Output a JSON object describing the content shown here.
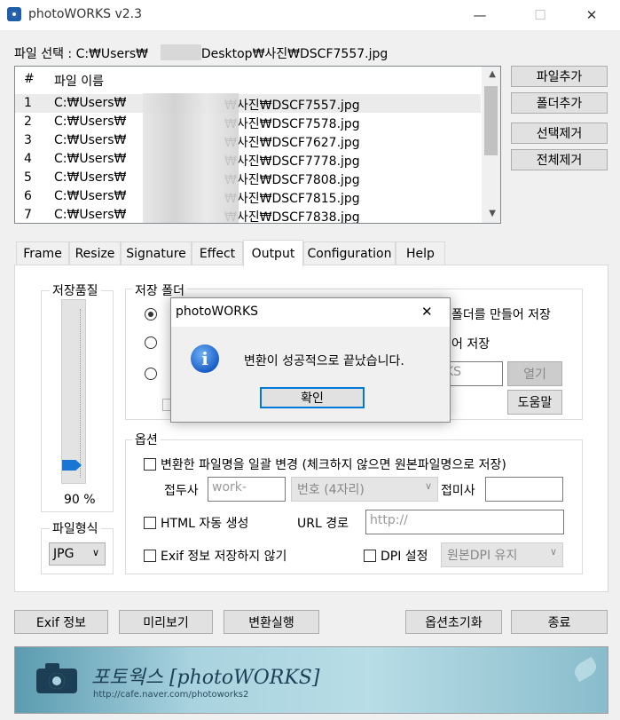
{
  "window": {
    "title": "photoWORKS v2.3",
    "minimize": "—",
    "maximize": "☐",
    "close": "✕"
  },
  "file_select": {
    "label": "파일 선택 : C:₩Users₩",
    "suffix": "₩Desktop₩사진₩DSCF7557.jpg"
  },
  "file_list": {
    "col_num": "#",
    "col_name": "파일 이름",
    "rows": [
      {
        "num": "1",
        "path": "C:₩Users₩",
        "file": "₩사진₩DSCF7557.jpg"
      },
      {
        "num": "2",
        "path": "C:₩Users₩",
        "file": "₩사진₩DSCF7578.jpg"
      },
      {
        "num": "3",
        "path": "C:₩Users₩",
        "file": "₩사진₩DSCF7627.jpg"
      },
      {
        "num": "4",
        "path": "C:₩Users₩",
        "file": "₩사진₩DSCF7778.jpg"
      },
      {
        "num": "5",
        "path": "C:₩Users₩",
        "file": "₩사진₩DSCF7808.jpg"
      },
      {
        "num": "6",
        "path": "C:₩Users₩",
        "file": "₩사진₩DSCF7815.jpg"
      },
      {
        "num": "7",
        "path": "C:₩Users₩",
        "file": "₩사진₩DSCF7838.jpg"
      }
    ]
  },
  "side_buttons": {
    "add_file": "파일추가",
    "add_folder": "폴더추가",
    "remove_selected": "선택제거",
    "remove_all": "전체제거"
  },
  "tabs": [
    "Frame",
    "Resize",
    "Signature",
    "Effect",
    "Output",
    "Configuration",
    "Help"
  ],
  "output": {
    "quality_label": "저장품질",
    "quality_value": "90 %",
    "quality_level": 0.9,
    "format_label": "파일형식",
    "format_value": "JPG",
    "folder_label": "저장 폴더",
    "folder_opt1_tail": "폴더를 만들어 저장",
    "folder_opt2_tail": "어 저장",
    "folder_input_tail": "KS",
    "open_button": "열기",
    "help_button": "도움말",
    "options_label": "옵션",
    "rename_check": "변환한 파일명을 일괄 변경 (체크하지 않으면 원본파일명으로 저장)",
    "prefix_label": "접두사",
    "prefix_placeholder": "work-",
    "number_select": "번호 (4자리)",
    "suffix_label": "접미사",
    "html_check": "HTML 자동 생성",
    "url_label": "URL 경로",
    "url_placeholder": "http://",
    "exif_check": "Exif 정보 저장하지 않기",
    "dpi_check": "DPI 설정",
    "dpi_select": "원본DPI 유지"
  },
  "bottom_buttons": {
    "exif": "Exif 정보",
    "preview": "미리보기",
    "convert": "변환실행",
    "reset": "옵션초기화",
    "exit": "종료"
  },
  "banner": {
    "title": "포토웍스 [photoWORKS]",
    "url": "http://cafe.naver.com/photoworks2"
  },
  "dialog": {
    "title": "photoWORKS",
    "message": "변환이 성공적으로 끝났습니다.",
    "ok": "확인",
    "close": "✕"
  }
}
